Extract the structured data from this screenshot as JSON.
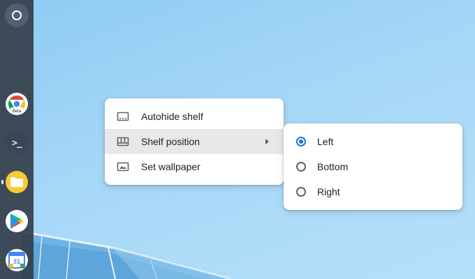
{
  "colors": {
    "shelf": "#343e4a",
    "menu_background": "#ffffff",
    "highlight": "#e8e8e8",
    "accent": "#1a73e8",
    "text": "#202124"
  },
  "shelf": {
    "launcher_icon": "launcher-circle-icon",
    "apps": [
      {
        "icon": "chrome-beta-icon",
        "badge": "Beta"
      },
      {
        "icon": "terminal-icon",
        "glyph": ">_"
      },
      {
        "icon": "files-icon",
        "active": true
      },
      {
        "icon": "play-store-icon"
      },
      {
        "icon": "calendar-icon",
        "badge": "31"
      }
    ]
  },
  "context_menu": {
    "items": [
      {
        "label": "Autohide shelf",
        "icon": "autohide-shelf-icon"
      },
      {
        "label": "Shelf position",
        "icon": "shelf-position-icon",
        "has_submenu": true,
        "highlighted": true
      },
      {
        "label": "Set wallpaper",
        "icon": "wallpaper-icon"
      }
    ]
  },
  "shelf_position_submenu": {
    "selected": "Left",
    "options": [
      {
        "label": "Left",
        "checked": true
      },
      {
        "label": "Bottom",
        "checked": false
      },
      {
        "label": "Right",
        "checked": false
      }
    ]
  }
}
